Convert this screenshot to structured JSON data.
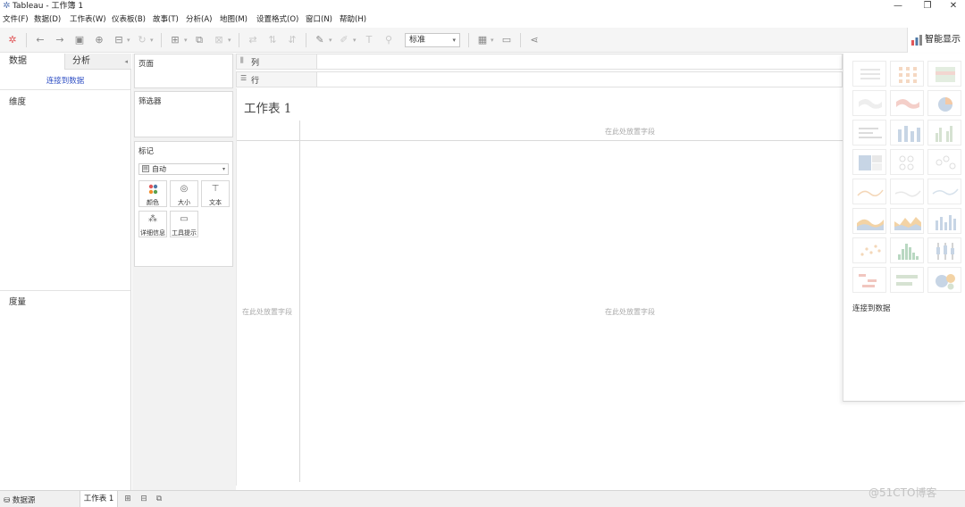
{
  "window": {
    "title": "Tableau - 工作簿 1",
    "minimize": "—",
    "restore": "❐",
    "close": "✕"
  },
  "menu": [
    "文件(F)",
    "数据(D)",
    "工作表(W)",
    "仪表板(B)",
    "故事(T)",
    "分析(A)",
    "地图(M)",
    "设置格式(O)",
    "窗口(N)",
    "帮助(H)"
  ],
  "toolbar": {
    "fit_value": "标准",
    "smart_show_label": "智能显示"
  },
  "left_pane": {
    "tab_data": "数据",
    "tab_analysis": "分析",
    "connect_link": "连接到数据",
    "dimensions": "维度",
    "measures": "度量"
  },
  "shelves": {
    "pages": "页面",
    "filters": "筛选器",
    "marks": "标记",
    "mark_type": "自动",
    "mark_buttons": [
      "颜色",
      "大小",
      "文本",
      "详细信息",
      "工具提示"
    ],
    "columns": "列",
    "rows": "行"
  },
  "canvas": {
    "sheet_title": "工作表 1",
    "drop_hint": "在此处放置字段"
  },
  "show_me": {
    "connect_text": "连接到数据"
  },
  "bottom": {
    "data_source_tab": "数据源",
    "sheet_tab": "工作表 1"
  },
  "watermark": "@51CTO博客",
  "colors": {
    "link": "#2f4fc4",
    "accent_blue": "#4e79a7",
    "accent_orange": "#f28e2b",
    "accent_green": "#59a14f",
    "accent_red": "#e15759"
  }
}
